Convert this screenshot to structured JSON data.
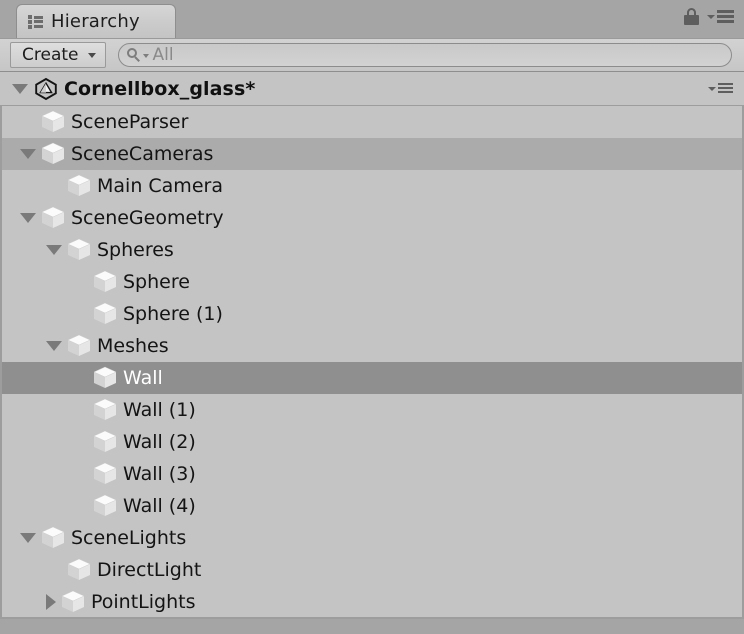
{
  "window": {
    "tab_label": "Hierarchy",
    "tab_icon": "list-tree-icon",
    "lock_icon": "lock-icon",
    "panel_menu_icon": "hamburger-menu-icon"
  },
  "toolbar": {
    "create_label": "Create",
    "create_caret_icon": "chevron-down-icon",
    "search_icon": "search-icon",
    "search_value": "",
    "search_placeholder": "All",
    "search_filter_caret_icon": "chevron-down-icon"
  },
  "scene": {
    "name": "Cornellbox_glass*",
    "expanded": true,
    "logo_icon": "unity-logo-icon",
    "context_menu_icon": "hamburger-menu-icon"
  },
  "colors": {
    "row_default": "#c4c4c4",
    "row_alt": "#ababab",
    "row_selected": "#8f8f8f",
    "selected_text": "#ffffff",
    "text": "#141414",
    "chrome": "#a5a5a5",
    "border": "#9d9d9d"
  },
  "tree": {
    "items": [
      {
        "label": "SceneParser",
        "depth": 1,
        "toggle": "none",
        "state": "default",
        "icon": "gameobject-cube-icon"
      },
      {
        "label": "SceneCameras",
        "depth": 1,
        "toggle": "expanded",
        "state": "alt",
        "icon": "gameobject-cube-icon"
      },
      {
        "label": "Main Camera",
        "depth": 2,
        "toggle": "none",
        "state": "default",
        "icon": "gameobject-cube-icon"
      },
      {
        "label": "SceneGeometry",
        "depth": 1,
        "toggle": "expanded",
        "state": "default",
        "icon": "gameobject-cube-icon"
      },
      {
        "label": "Spheres",
        "depth": 2,
        "toggle": "expanded",
        "state": "default",
        "icon": "gameobject-cube-icon"
      },
      {
        "label": "Sphere",
        "depth": 3,
        "toggle": "none",
        "state": "default",
        "icon": "gameobject-cube-icon"
      },
      {
        "label": "Sphere (1)",
        "depth": 3,
        "toggle": "none",
        "state": "default",
        "icon": "gameobject-cube-icon"
      },
      {
        "label": "Meshes",
        "depth": 2,
        "toggle": "expanded",
        "state": "default",
        "icon": "gameobject-cube-icon"
      },
      {
        "label": "Wall",
        "depth": 3,
        "toggle": "none",
        "state": "selected",
        "icon": "gameobject-cube-icon"
      },
      {
        "label": "Wall (1)",
        "depth": 3,
        "toggle": "none",
        "state": "default",
        "icon": "gameobject-cube-icon"
      },
      {
        "label": "Wall (2)",
        "depth": 3,
        "toggle": "none",
        "state": "default",
        "icon": "gameobject-cube-icon"
      },
      {
        "label": "Wall (3)",
        "depth": 3,
        "toggle": "none",
        "state": "default",
        "icon": "gameobject-cube-icon"
      },
      {
        "label": "Wall (4)",
        "depth": 3,
        "toggle": "none",
        "state": "default",
        "icon": "gameobject-cube-icon"
      },
      {
        "label": "SceneLights",
        "depth": 1,
        "toggle": "expanded",
        "state": "default",
        "icon": "gameobject-cube-icon"
      },
      {
        "label": "DirectLight",
        "depth": 2,
        "toggle": "none",
        "state": "default",
        "icon": "gameobject-cube-icon"
      },
      {
        "label": "PointLights",
        "depth": 2,
        "toggle": "collapsed",
        "state": "default",
        "icon": "gameobject-cube-icon"
      }
    ]
  }
}
